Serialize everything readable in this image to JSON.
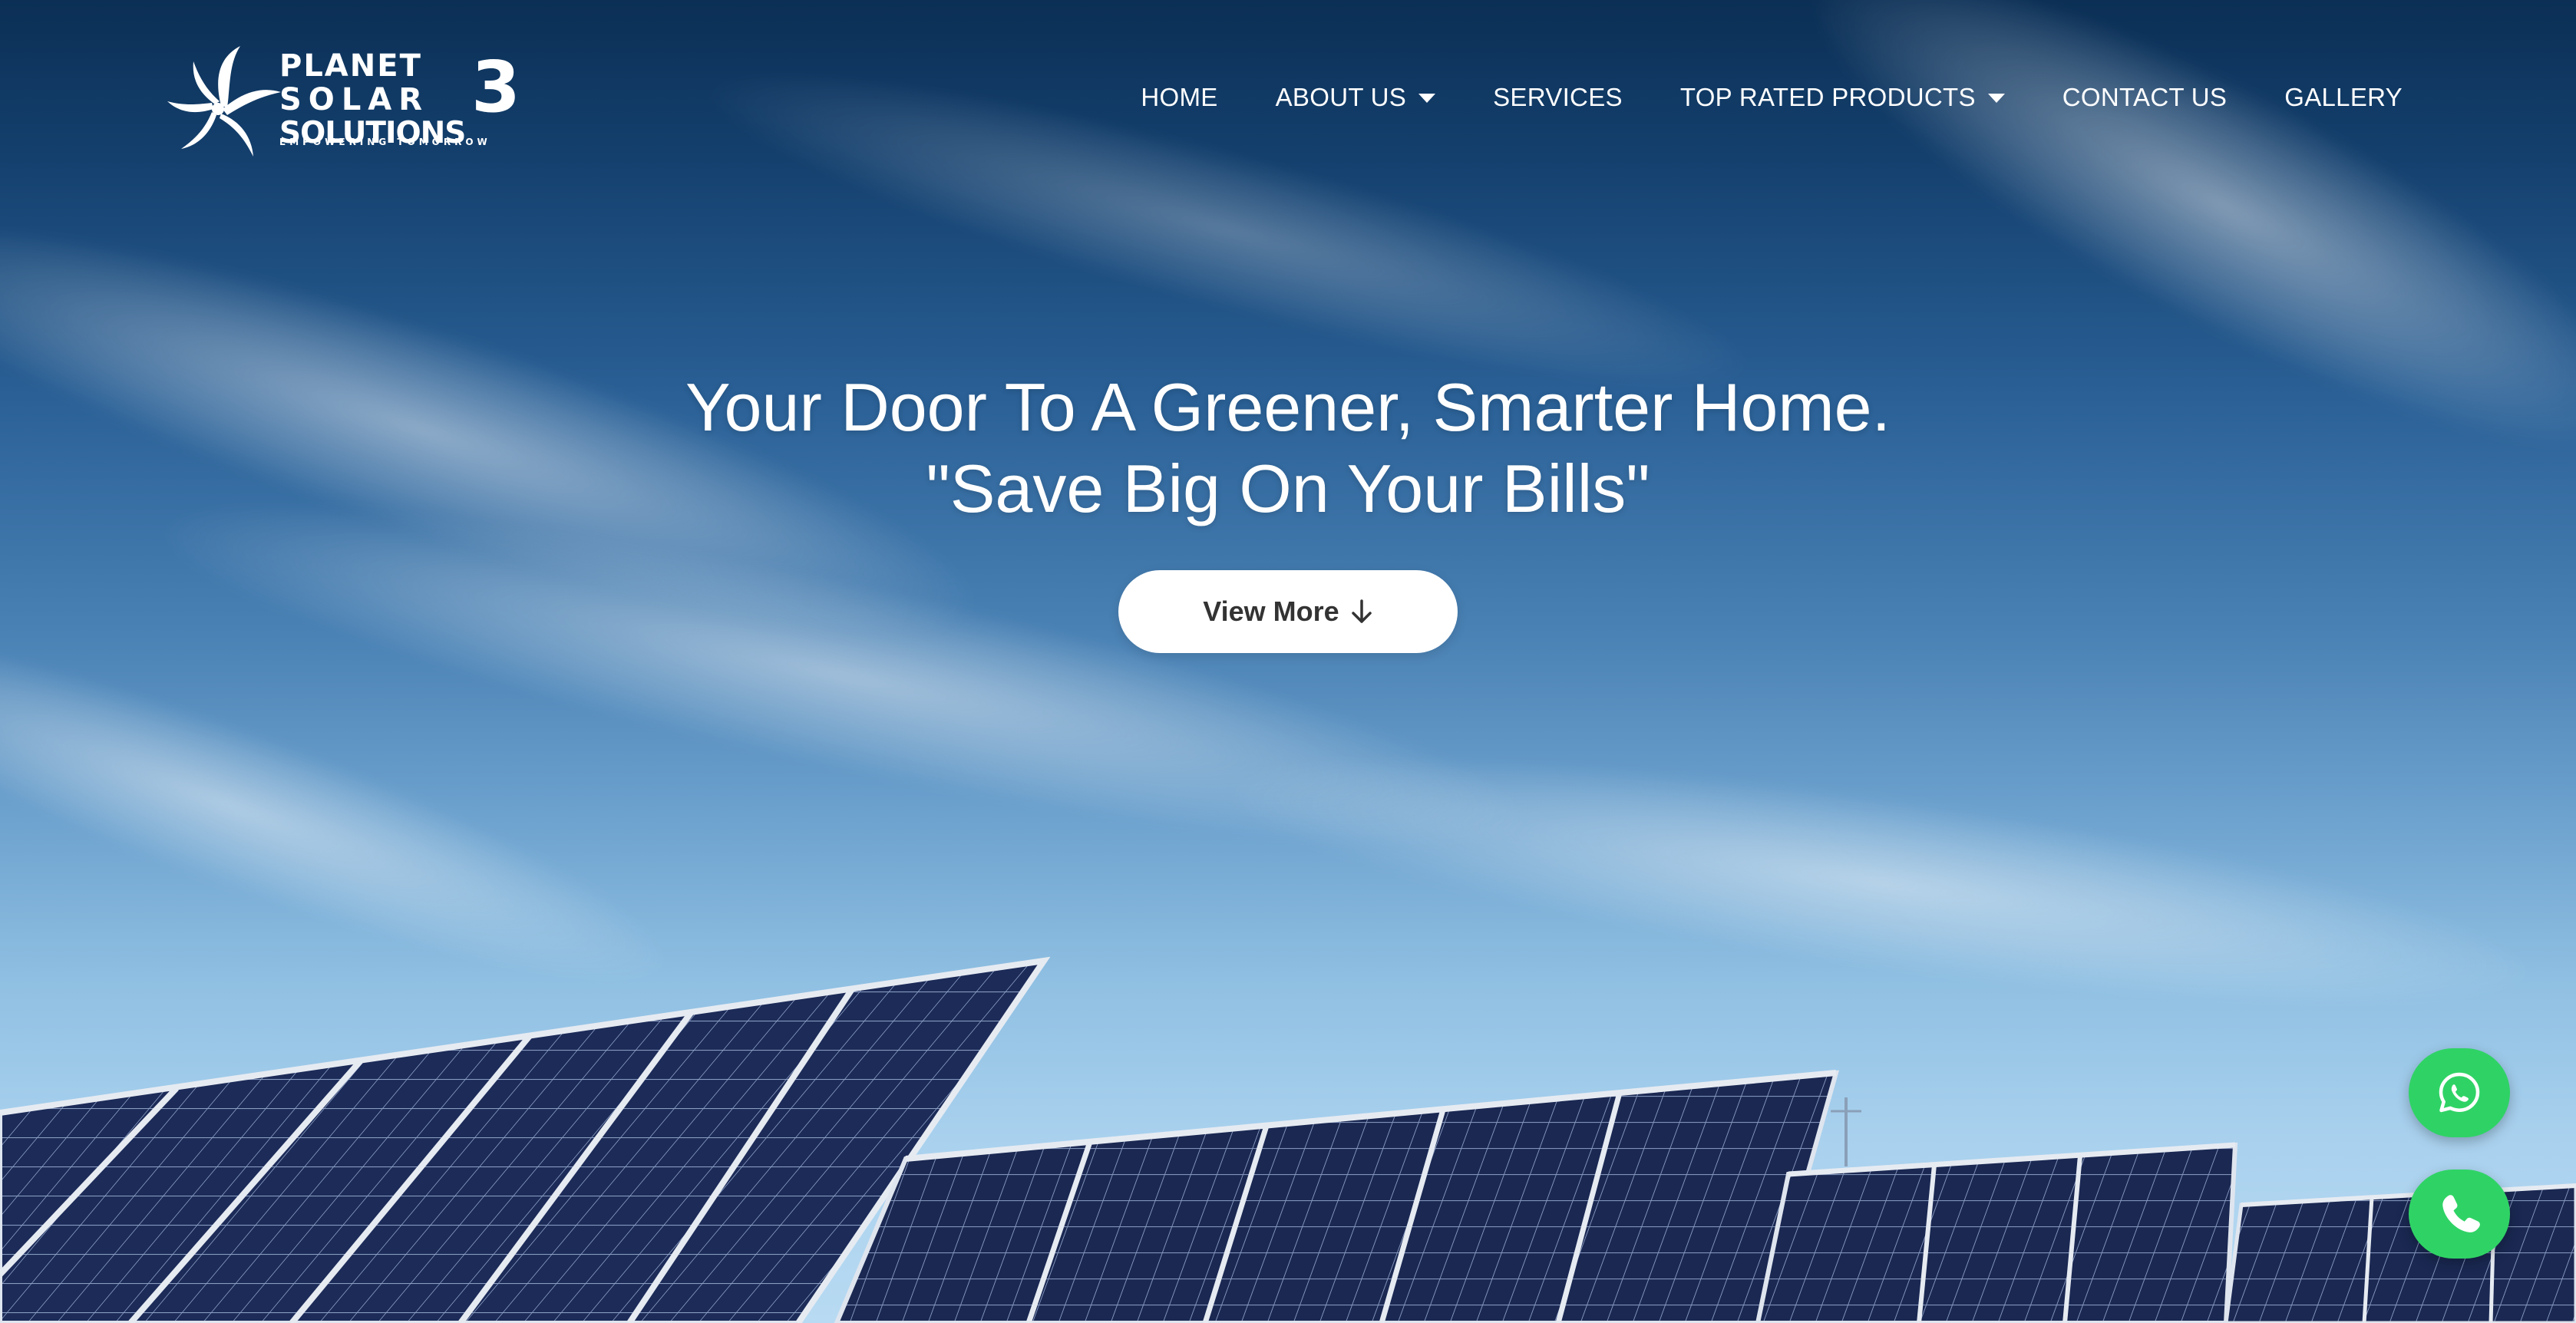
{
  "header": {
    "logo": {
      "line1": "PLANET",
      "line2": "SOLAR",
      "line3": "SOLUTIONS",
      "number": "3",
      "tagline": "EMPOWERING TOMORROW",
      "icon": "sunburst-logo-icon"
    },
    "nav": {
      "items": [
        {
          "label": "HOME",
          "dropdown": false
        },
        {
          "label": "ABOUT US",
          "dropdown": true
        },
        {
          "label": "SERVICES",
          "dropdown": false
        },
        {
          "label": "TOP RATED PRODUCTS",
          "dropdown": true
        },
        {
          "label": "CONTACT US",
          "dropdown": false
        },
        {
          "label": "GALLERY",
          "dropdown": false
        }
      ]
    }
  },
  "hero": {
    "title_line1": "Your Door To A Greener, Smarter Home.",
    "title_line2": "\"Save Big On Your Bills\"",
    "button_label": "View More",
    "button_icon": "arrow-down-icon"
  },
  "floating": {
    "whatsapp_icon": "whatsapp-icon",
    "phone_icon": "phone-icon",
    "color": "#2fd365"
  },
  "colors": {
    "sky_top": "#0b2f55",
    "sky_bottom": "#b8daf2",
    "panel_cell": "#1b2a55",
    "panel_frame": "#d7dde6"
  }
}
